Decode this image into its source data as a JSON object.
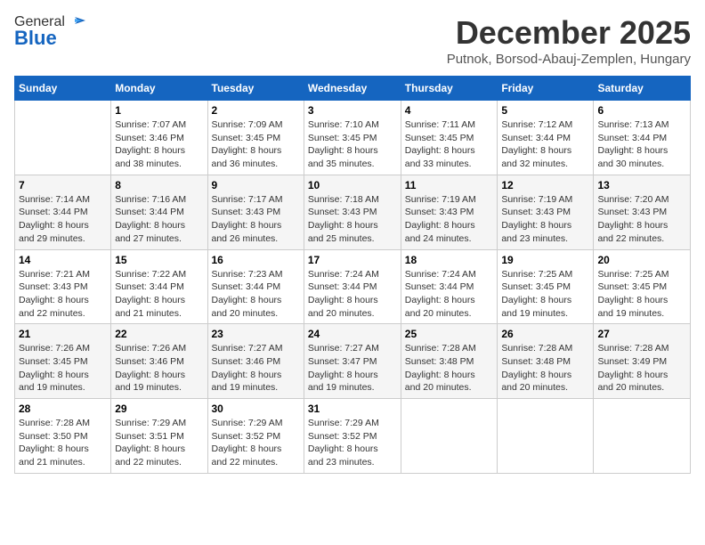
{
  "logo": {
    "general": "General",
    "blue": "Blue"
  },
  "title": "December 2025",
  "location": "Putnok, Borsod-Abauj-Zemplen, Hungary",
  "days_of_week": [
    "Sunday",
    "Monday",
    "Tuesday",
    "Wednesday",
    "Thursday",
    "Friday",
    "Saturday"
  ],
  "weeks": [
    [
      {
        "day": "",
        "info": ""
      },
      {
        "day": "1",
        "info": "Sunrise: 7:07 AM\nSunset: 3:46 PM\nDaylight: 8 hours\nand 38 minutes."
      },
      {
        "day": "2",
        "info": "Sunrise: 7:09 AM\nSunset: 3:45 PM\nDaylight: 8 hours\nand 36 minutes."
      },
      {
        "day": "3",
        "info": "Sunrise: 7:10 AM\nSunset: 3:45 PM\nDaylight: 8 hours\nand 35 minutes."
      },
      {
        "day": "4",
        "info": "Sunrise: 7:11 AM\nSunset: 3:45 PM\nDaylight: 8 hours\nand 33 minutes."
      },
      {
        "day": "5",
        "info": "Sunrise: 7:12 AM\nSunset: 3:44 PM\nDaylight: 8 hours\nand 32 minutes."
      },
      {
        "day": "6",
        "info": "Sunrise: 7:13 AM\nSunset: 3:44 PM\nDaylight: 8 hours\nand 30 minutes."
      }
    ],
    [
      {
        "day": "7",
        "info": "Sunrise: 7:14 AM\nSunset: 3:44 PM\nDaylight: 8 hours\nand 29 minutes."
      },
      {
        "day": "8",
        "info": "Sunrise: 7:16 AM\nSunset: 3:44 PM\nDaylight: 8 hours\nand 27 minutes."
      },
      {
        "day": "9",
        "info": "Sunrise: 7:17 AM\nSunset: 3:43 PM\nDaylight: 8 hours\nand 26 minutes."
      },
      {
        "day": "10",
        "info": "Sunrise: 7:18 AM\nSunset: 3:43 PM\nDaylight: 8 hours\nand 25 minutes."
      },
      {
        "day": "11",
        "info": "Sunrise: 7:19 AM\nSunset: 3:43 PM\nDaylight: 8 hours\nand 24 minutes."
      },
      {
        "day": "12",
        "info": "Sunrise: 7:19 AM\nSunset: 3:43 PM\nDaylight: 8 hours\nand 23 minutes."
      },
      {
        "day": "13",
        "info": "Sunrise: 7:20 AM\nSunset: 3:43 PM\nDaylight: 8 hours\nand 22 minutes."
      }
    ],
    [
      {
        "day": "14",
        "info": "Sunrise: 7:21 AM\nSunset: 3:43 PM\nDaylight: 8 hours\nand 22 minutes."
      },
      {
        "day": "15",
        "info": "Sunrise: 7:22 AM\nSunset: 3:44 PM\nDaylight: 8 hours\nand 21 minutes."
      },
      {
        "day": "16",
        "info": "Sunrise: 7:23 AM\nSunset: 3:44 PM\nDaylight: 8 hours\nand 20 minutes."
      },
      {
        "day": "17",
        "info": "Sunrise: 7:24 AM\nSunset: 3:44 PM\nDaylight: 8 hours\nand 20 minutes."
      },
      {
        "day": "18",
        "info": "Sunrise: 7:24 AM\nSunset: 3:44 PM\nDaylight: 8 hours\nand 20 minutes."
      },
      {
        "day": "19",
        "info": "Sunrise: 7:25 AM\nSunset: 3:45 PM\nDaylight: 8 hours\nand 19 minutes."
      },
      {
        "day": "20",
        "info": "Sunrise: 7:25 AM\nSunset: 3:45 PM\nDaylight: 8 hours\nand 19 minutes."
      }
    ],
    [
      {
        "day": "21",
        "info": "Sunrise: 7:26 AM\nSunset: 3:45 PM\nDaylight: 8 hours\nand 19 minutes."
      },
      {
        "day": "22",
        "info": "Sunrise: 7:26 AM\nSunset: 3:46 PM\nDaylight: 8 hours\nand 19 minutes."
      },
      {
        "day": "23",
        "info": "Sunrise: 7:27 AM\nSunset: 3:46 PM\nDaylight: 8 hours\nand 19 minutes."
      },
      {
        "day": "24",
        "info": "Sunrise: 7:27 AM\nSunset: 3:47 PM\nDaylight: 8 hours\nand 19 minutes."
      },
      {
        "day": "25",
        "info": "Sunrise: 7:28 AM\nSunset: 3:48 PM\nDaylight: 8 hours\nand 20 minutes."
      },
      {
        "day": "26",
        "info": "Sunrise: 7:28 AM\nSunset: 3:48 PM\nDaylight: 8 hours\nand 20 minutes."
      },
      {
        "day": "27",
        "info": "Sunrise: 7:28 AM\nSunset: 3:49 PM\nDaylight: 8 hours\nand 20 minutes."
      }
    ],
    [
      {
        "day": "28",
        "info": "Sunrise: 7:28 AM\nSunset: 3:50 PM\nDaylight: 8 hours\nand 21 minutes."
      },
      {
        "day": "29",
        "info": "Sunrise: 7:29 AM\nSunset: 3:51 PM\nDaylight: 8 hours\nand 22 minutes."
      },
      {
        "day": "30",
        "info": "Sunrise: 7:29 AM\nSunset: 3:52 PM\nDaylight: 8 hours\nand 22 minutes."
      },
      {
        "day": "31",
        "info": "Sunrise: 7:29 AM\nSunset: 3:52 PM\nDaylight: 8 hours\nand 23 minutes."
      },
      {
        "day": "",
        "info": ""
      },
      {
        "day": "",
        "info": ""
      },
      {
        "day": "",
        "info": ""
      }
    ]
  ]
}
